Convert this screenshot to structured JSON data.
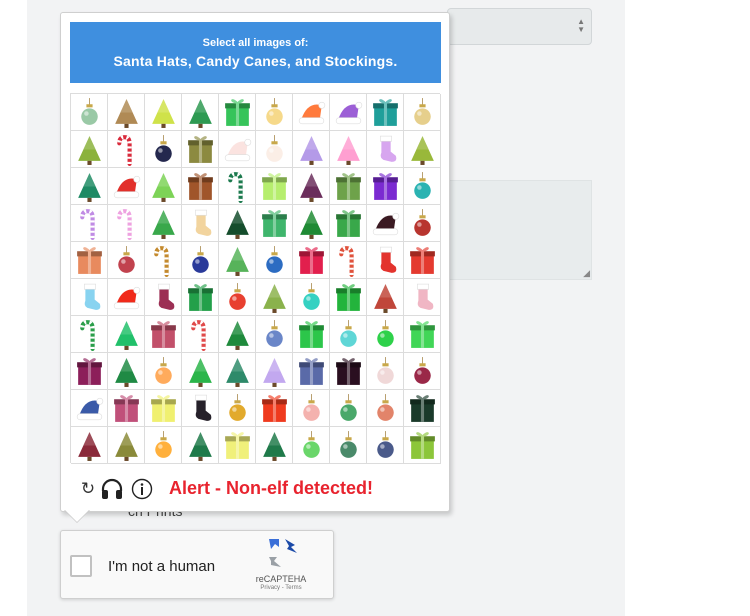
{
  "challenge": {
    "instruction_line1": "Select all images of:",
    "instruction_line2": "Santa Hats, Candy Canes, and Stockings.",
    "alert": "Alert - Non-elf detected!",
    "grid": [
      [
        "ornament:#9ac9a6",
        "tree:#b08a55",
        "tree:#cfe24a",
        "tree:#2e9a52",
        "gift:#36c45a",
        "ornament:#f6d98a",
        "hat:#ff7a3c",
        "hat:#9c5fd6",
        "gift:#1f9f9a",
        "ornament:#e6cf8c"
      ],
      [
        "tree:#8bb23c",
        "cane:#d92b3c",
        "ornament:#24284e",
        "gift:#8c8a40",
        "hat:#fbe3e0",
        "ornament:#fbeee6",
        "tree:#b49ae8",
        "tree:#ff9fd1",
        "stocking:#d7a6ef",
        "tree:#99b83a"
      ],
      [
        "tree:#1f8a64",
        "hat:#e2302b",
        "tree:#7dd357",
        "gift:#a0552a",
        "cane:#1c7a4e",
        "gift:#b6ee6e",
        "tree:#6b2e5c",
        "gift:#6ea24a",
        "gift:#7b2ad1",
        "ornament:#2bb3b2"
      ],
      [
        "cane:#c08be4",
        "cane:#eea2e0",
        "tree:#39a84b",
        "stocking:#f2d49e",
        "tree:#154d2c",
        "gift:#3fb56c",
        "tree:#1f8a34",
        "gift:#39a84a",
        "hat:#3b1a22",
        "ornament:#b8352f"
      ],
      [
        "gift:#e88a5e",
        "ornament:#c1424e",
        "cane:#c48a2e",
        "ornament:#2a3a9a",
        "tree:#57b35a",
        "ornament:#2c6cc2",
        "gift:#e21f4d",
        "cane:#e0523c",
        "stocking:#e3332d",
        "gift:#e43a2f"
      ],
      [
        "stocking:#88d3f0",
        "hat:#f02a1a",
        "stocking:#9c2f54",
        "gift:#23a04a",
        "ornament:#e84030",
        "tree:#8ab24c",
        "ornament:#35d1c2",
        "gift:#23b43c",
        "tree:#c0463a",
        "stocking:#f0b6c4"
      ],
      [
        "cane:#2a9e4a",
        "tree:#21c06a",
        "gift:#c2506a",
        "cane:#e04a4a",
        "tree:#1f8a3c",
        "ornament:#6a86c8",
        "gift:#2cc64a",
        "ornament:#5fd6d6",
        "ornament:#2ed14a",
        "gift:#41d657"
      ],
      [
        "gift:#8c1f5a",
        "tree:#1f8a44",
        "ornament:#ffab5c",
        "tree:#2bb54a",
        "tree:#2e8a6a",
        "tree:#c2a8ef",
        "gift:#5a6aa8",
        "gift:#2a0f20",
        "ornament:#f0d8d8",
        "ornament:#9a2848"
      ],
      [
        "hat:#3a5aa8",
        "gift:#c0507a",
        "gift:#f0f070",
        "stocking:#26212a",
        "ornament:#e2aa2c",
        "gift:#ef3a1e",
        "ornament:#f4b2ae",
        "ornament:#4aa86a",
        "ornament:#e2846a",
        "gift:#1a3a2a"
      ],
      [
        "tree:#8a2a3a",
        "tree:#8a8a3a",
        "ornament:#ffb03c",
        "tree:#1f7a4a",
        "gift:#f0f07a",
        "tree:#1f7a4a",
        "ornament:#6ad66a",
        "ornament:#4a8a6a",
        "ornament:#4a5a8a",
        "gift:#8cc63a"
      ]
    ]
  },
  "footer": {
    "reload_glyph": "↻",
    "info_glyph": "ⓘ"
  },
  "checkbox_widget": {
    "label": "I'm not a human",
    "brand": "reCAPTEHA",
    "links": "Privacy - Terms"
  },
  "background": {
    "hidden_label": "ch Prints"
  },
  "colors": {
    "header_blue": "#3f8fdf",
    "alert_red": "#e8232e",
    "cell_border": "#dcdcdc"
  }
}
